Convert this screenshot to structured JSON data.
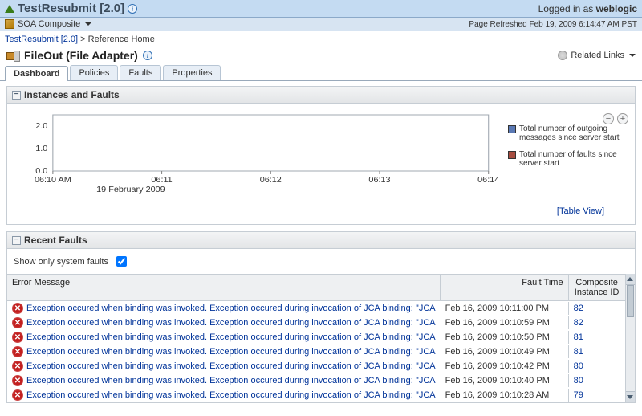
{
  "banner": {
    "title": "TestResubmit [2.0]",
    "logged_in_prefix": "Logged in as",
    "user": "weblogic"
  },
  "compositeBar": {
    "label": "SOA Composite",
    "refreshed": "Page Refreshed Feb 19, 2009 6:14:47 AM PST"
  },
  "breadcrumb": {
    "link": "TestResubmit [2.0]",
    "sep": ">",
    "current": "Reference Home"
  },
  "page": {
    "title": "FileOut (File Adapter)",
    "relatedLinks": "Related Links"
  },
  "tabs": [
    "Dashboard",
    "Policies",
    "Faults",
    "Properties"
  ],
  "sections": {
    "chart": "Instances and Faults",
    "recent": "Recent Faults"
  },
  "chart_data": {
    "type": "line",
    "title": "",
    "series": [
      {
        "name": "Total number of outgoing messages since server start",
        "color": "#5a79b4",
        "values": [
          0,
          0,
          0,
          0,
          0
        ]
      },
      {
        "name": "Total number of faults since server start",
        "color": "#a64c3f",
        "values": [
          0,
          0,
          0,
          0,
          0
        ]
      }
    ],
    "y_ticks": [
      0.0,
      1.0,
      2.0
    ],
    "x_ticks": [
      "06:10 AM",
      "06:11",
      "06:12",
      "06:13",
      "06:14"
    ],
    "x_subtitle": "19 February 2009",
    "ylim": [
      0.0,
      2.5
    ]
  },
  "tableViewLink": "[Table View]",
  "showOnlyLabel": "Show only system faults",
  "showOnlyChecked": true,
  "faultHeaders": {
    "msg": "Error Message",
    "time": "Fault Time",
    "id": "Composite Instance ID"
  },
  "faults": [
    {
      "msg": "Exception occured when binding was invoked. Exception occured during invocation of JCA binding: \"JCA",
      "time": "Feb 16, 2009 10:11:00 PM",
      "id": "82"
    },
    {
      "msg": "Exception occured when binding was invoked. Exception occured during invocation of JCA binding: \"JCA",
      "time": "Feb 16, 2009 10:10:59 PM",
      "id": "82"
    },
    {
      "msg": "Exception occured when binding was invoked. Exception occured during invocation of JCA binding: \"JCA",
      "time": "Feb 16, 2009 10:10:50 PM",
      "id": "81"
    },
    {
      "msg": "Exception occured when binding was invoked. Exception occured during invocation of JCA binding: \"JCA",
      "time": "Feb 16, 2009 10:10:49 PM",
      "id": "81"
    },
    {
      "msg": "Exception occured when binding was invoked. Exception occured during invocation of JCA binding: \"JCA",
      "time": "Feb 16, 2009 10:10:42 PM",
      "id": "80"
    },
    {
      "msg": "Exception occured when binding was invoked. Exception occured during invocation of JCA binding: \"JCA",
      "time": "Feb 16, 2009 10:10:40 PM",
      "id": "80"
    },
    {
      "msg": "Exception occured when binding was invoked. Exception occured during invocation of JCA binding: \"JCA",
      "time": "Feb 16, 2009 10:10:28 AM",
      "id": "79"
    }
  ]
}
